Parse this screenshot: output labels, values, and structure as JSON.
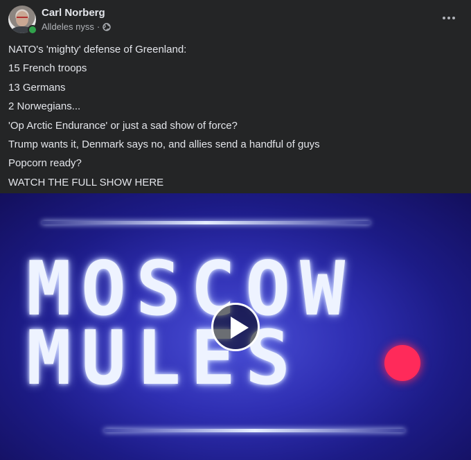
{
  "post": {
    "author": "Carl Norberg",
    "timestamp": "Alldeles nyss",
    "separator": "·",
    "privacy_icon": "globe-icon",
    "online_status_color": "#31a24c",
    "more_icon": "more-options-icon",
    "lines": [
      "NATO's 'mighty' defense of Greenland:",
      "15 French troops",
      "13 Germans",
      "2 Norwegians...",
      "'Op Arctic Endurance' or just a sad show of force?",
      "Trump wants it, Denmark says no, and allies send a handful of guys",
      "Popcorn ready?",
      "WATCH THE FULL SHOW HERE"
    ]
  },
  "video": {
    "title_line1": "MOSCOW",
    "title_line2": "MULES",
    "play_icon": "play-icon",
    "accent_dot_color": "#ff2a5a"
  }
}
